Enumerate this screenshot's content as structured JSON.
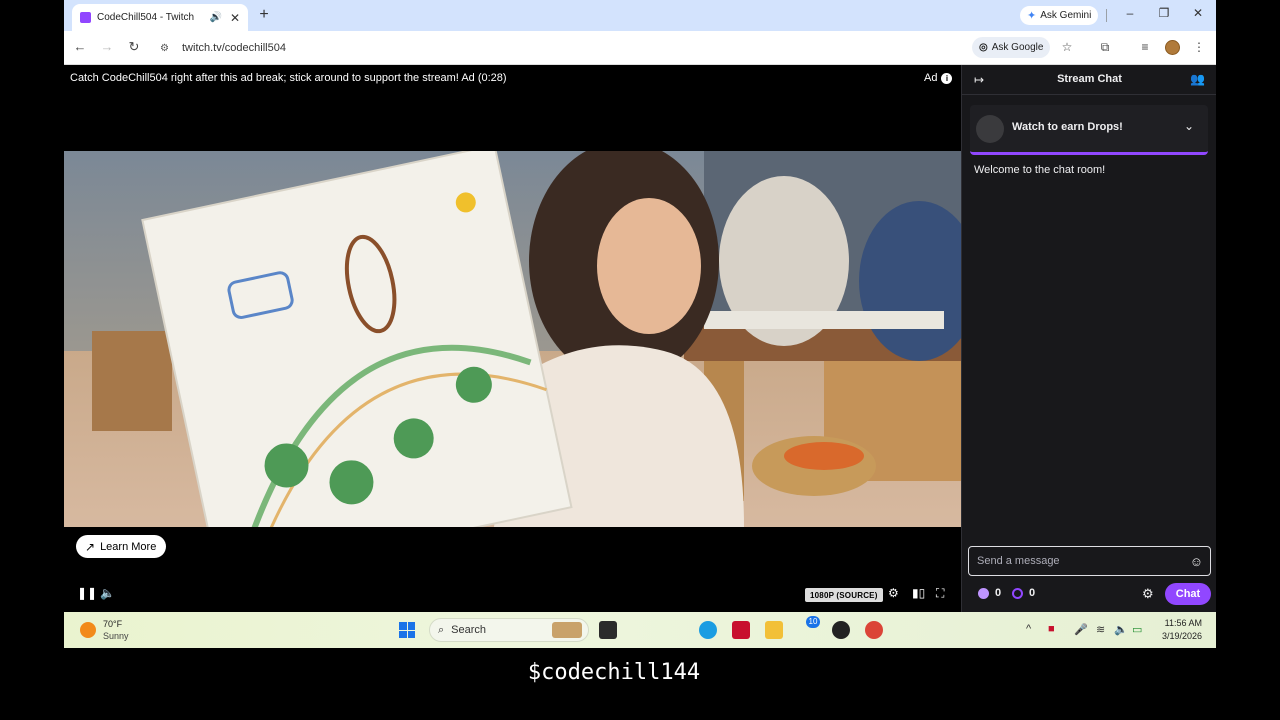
{
  "browser": {
    "tab_title": "CodeChill504 - Twitch",
    "new_tab": "+",
    "ask_gemini": "Ask Gemini",
    "url": "twitch.tv/codechill504",
    "ask_google": "Ask Google"
  },
  "player": {
    "ad_banner": "Catch CodeChill504 right after this ad break; stick around to support the stream! Ad (0:28)",
    "ad_label": "Ad",
    "learn_more": "Learn More",
    "quality": "1080P (SOURCE)"
  },
  "chat": {
    "title": "Stream Chat",
    "drops": "Watch to earn Drops!",
    "welcome": "Welcome to the chat room!",
    "input_placeholder": "Send a message",
    "points_a": "0",
    "points_b": "0",
    "chat_button": "Chat",
    "accent": "#9147ff"
  },
  "taskbar": {
    "temp": "70°F",
    "condition": "Sunny",
    "search": "Search",
    "badge": "10",
    "time": "11:56 AM",
    "date": "3/19/2026"
  },
  "caption": "$codechill144"
}
